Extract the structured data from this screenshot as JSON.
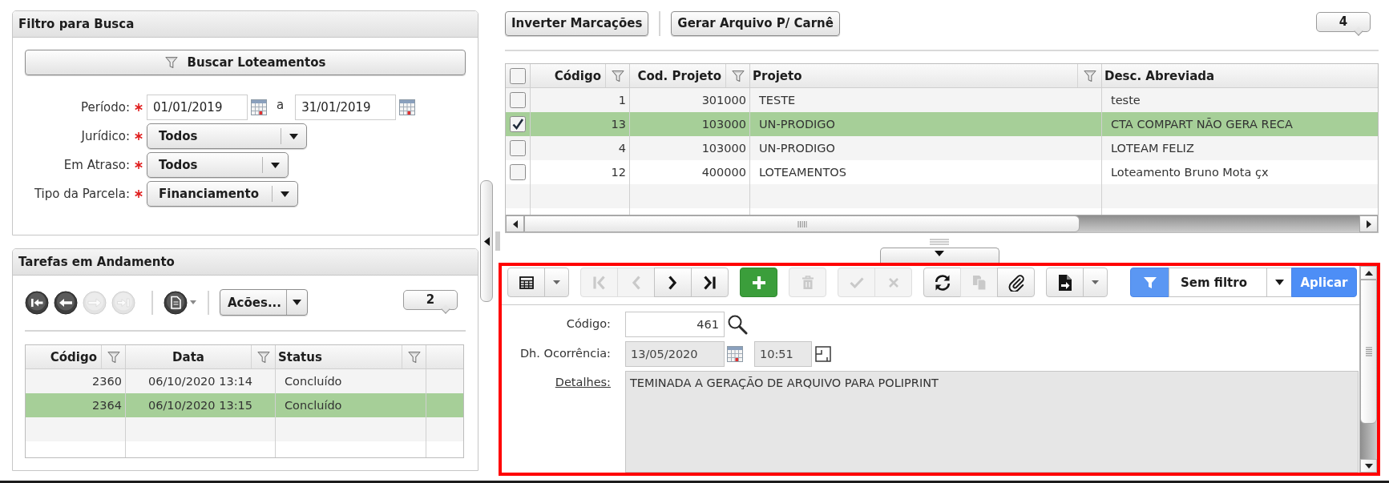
{
  "filter_panel": {
    "title": "Filtro para Busca",
    "search_button": "Buscar Loteamentos",
    "fields": [
      {
        "kind": "date_range",
        "label": "Período:",
        "required": true,
        "from": "01/01/2019",
        "separator": "a",
        "to": "31/01/2019"
      },
      {
        "kind": "select",
        "label": "Jurídico:",
        "required": true,
        "value": "Todos"
      },
      {
        "kind": "select",
        "label": "Em Atraso:",
        "required": true,
        "value": "Todos"
      },
      {
        "kind": "select",
        "label": "Tipo da Parcela:",
        "required": true,
        "value": "Financiamento"
      }
    ]
  },
  "tasks_panel": {
    "title": "Tarefas em Andamento",
    "nav_buttons": [
      {
        "kind": "first",
        "disabled": false
      },
      {
        "kind": "previous",
        "disabled": false
      },
      {
        "kind": "next",
        "disabled": true
      },
      {
        "kind": "last",
        "disabled": true
      }
    ],
    "actions_button": "Acões...",
    "count": "2",
    "table": {
      "columns": [
        {
          "label": "Código",
          "filter": true
        },
        {
          "label": "Data",
          "filter": true
        },
        {
          "label": "Status",
          "filter": true
        }
      ],
      "rows": [
        {
          "cells": [
            "2360",
            "06/10/2020 13:14",
            "Concluído"
          ],
          "selected": false
        },
        {
          "cells": [
            "2364",
            "06/10/2020 13:15",
            "Concluído"
          ],
          "selected": true
        }
      ]
    }
  },
  "actions_bar": {
    "buttons": [
      "Inverter Marcações",
      "Gerar Arquivo P/ Carnê"
    ],
    "count": "4"
  },
  "projects_table": {
    "header_checked": false,
    "columns": [
      {
        "label": "Código",
        "filter": true
      },
      {
        "label": "Cod. Projeto",
        "filter": true
      },
      {
        "label": "Projeto",
        "filter": true
      },
      {
        "label": "Desc. Abreviada",
        "filter": false
      }
    ],
    "rows": [
      {
        "checked": false,
        "selected": false,
        "cells": [
          "1",
          "301000",
          "TESTE",
          "teste"
        ]
      },
      {
        "checked": true,
        "selected": true,
        "cells": [
          "13",
          "103000",
          "UN-PRODIGO",
          "CTA COMPART NÃO GERA RECA"
        ]
      },
      {
        "checked": false,
        "selected": false,
        "cells": [
          "4",
          "103000",
          "UN-PRODIGO",
          "LOTEAM FELIZ"
        ]
      },
      {
        "checked": false,
        "selected": false,
        "cells": [
          "12",
          "400000",
          "LOTEAMENTOS",
          "Loteamento Bruno Mota çx"
        ]
      }
    ]
  },
  "detail_panel": {
    "highlighted": true,
    "toolbar_groups": [
      [
        {
          "kind": "grid",
          "disabled": false
        },
        {
          "kind": "menu",
          "disabled": false
        }
      ],
      [
        {
          "kind": "first",
          "disabled": true
        },
        {
          "kind": "previous",
          "disabled": true
        },
        {
          "kind": "next",
          "disabled": false
        },
        {
          "kind": "last",
          "disabled": false
        }
      ],
      [
        {
          "kind": "add",
          "disabled": false
        }
      ],
      [
        {
          "kind": "delete",
          "disabled": true
        }
      ],
      [
        {
          "kind": "save",
          "disabled": true
        },
        {
          "kind": "cancel",
          "disabled": true
        }
      ],
      [
        {
          "kind": "refresh",
          "disabled": false
        },
        {
          "kind": "copy",
          "disabled": true
        },
        {
          "kind": "attach",
          "disabled": false
        }
      ],
      [
        {
          "kind": "export",
          "disabled": false
        },
        {
          "kind": "menu",
          "disabled": false
        }
      ]
    ],
    "filter": {
      "value": "Sem filtro"
    },
    "apply_button": "Aplicar",
    "fields": [
      {
        "kind": "lookup",
        "label": "Código:",
        "link": false,
        "value": "461",
        "disabled": false
      },
      {
        "kind": "datetime",
        "label": "Dh. Ocorrência:",
        "link": false,
        "date": "13/05/2020",
        "time": "10:51",
        "disabled": true
      },
      {
        "kind": "memo",
        "label": "Detalhes:",
        "link": true,
        "value": "TEMINADA A GERAÇÃO DE ARQUIVO PARA POLIPRINT",
        "disabled": true
      }
    ]
  }
}
